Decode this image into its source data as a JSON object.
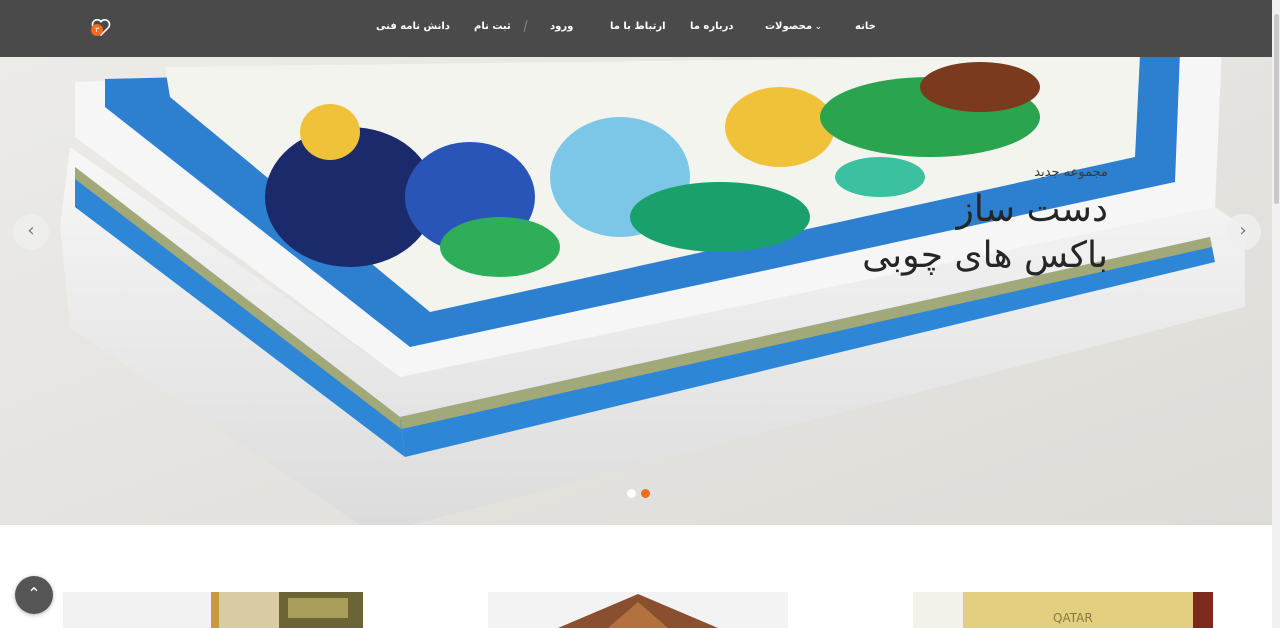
{
  "nav": {
    "items": [
      {
        "label": "خانه"
      },
      {
        "label": "محصولات"
      },
      {
        "label": "درباره ما"
      },
      {
        "label": "ارتباط با ما"
      },
      {
        "label": "ورود"
      },
      {
        "label": "ثبت نام"
      },
      {
        "label": "دانش نامه فنی"
      }
    ],
    "wishlist_count": "۳",
    "colors": {
      "bar": "#4a4a4a",
      "accent": "#f26b21"
    }
  },
  "hero": {
    "subtitle": "مجموعه جدید",
    "title_line1": "دست ساز",
    "title_line2": "باکس های چوبی",
    "slides": [
      {
        "active": false
      },
      {
        "active": true
      }
    ],
    "image_icon": "painted-tile-box-image"
  },
  "ui": {
    "scroll_top_icon": "chevron-up-icon",
    "prev_icon": "chevron-left-icon",
    "next_icon": "chevron-right-icon"
  }
}
